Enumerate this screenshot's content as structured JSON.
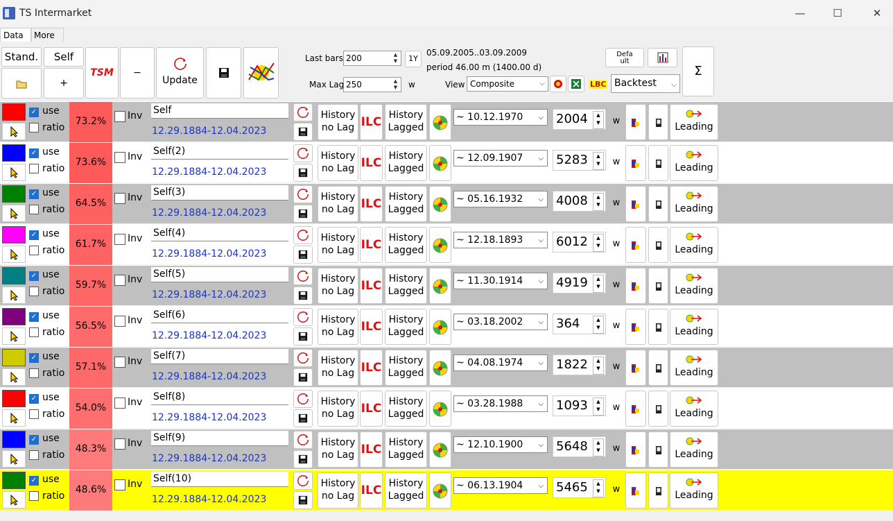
{
  "window": {
    "title": "TS Intermarket",
    "minimize": "—",
    "maximize": "☐",
    "close": "✕"
  },
  "tabs": [
    {
      "label": "Data"
    },
    {
      "label": "More"
    }
  ],
  "toolbar": {
    "stand_label": "Stand.",
    "self_label": "Self",
    "tsm_label": "TSM",
    "minus_label": "−",
    "plus_label": "+",
    "update_label": "Update",
    "last_bars_label": "Last bars",
    "last_bars_value": "200",
    "one_y_label": "1Y",
    "max_lag_label": "Max Lag",
    "max_lag_value": "250",
    "max_lag_unit": "w",
    "date_range": "05.09.2005..03.09.2009",
    "period": "period 46.00 m (1400.00 d)",
    "view_label": "View",
    "view_value": "Composite",
    "default_label_1": "Defa",
    "default_label_2": "ult",
    "lbc_label": "LBC",
    "backtest_value": "Backtest",
    "sigma_label": "Σ"
  },
  "row_labels": {
    "use": "use",
    "ratio": "ratio",
    "inv": "Inv",
    "history_nolag_1": "History",
    "history_nolag_2": "no Lag",
    "ilc": "ILC",
    "history_lagged_1": "History",
    "history_lagged_2": "Lagged",
    "unit": "w",
    "leading": "Leading"
  },
  "rows": [
    {
      "color": "#ff0000",
      "pct": "73.2%",
      "pct_color": "#ff5a5a",
      "name": "Self",
      "range": "12.29.1884-12.04.2023",
      "date": "~ 10.12.1970",
      "lag": "2004",
      "bg": "gray"
    },
    {
      "color": "#0000ff",
      "pct": "73.6%",
      "pct_color": "#ff5a5a",
      "name": "Self(2)",
      "range": "12.29.1884-12.04.2023",
      "date": "~ 12.09.1907",
      "lag": "5283",
      "bg": "white"
    },
    {
      "color": "#008000",
      "pct": "64.5%",
      "pct_color": "#ff6060",
      "name": "Self(3)",
      "range": "12.29.1884-12.04.2023",
      "date": "~ 05.16.1932",
      "lag": "4008",
      "bg": "gray"
    },
    {
      "color": "#ff00ff",
      "pct": "61.7%",
      "pct_color": "#ff6363",
      "name": "Self(4)",
      "range": "12.29.1884-12.04.2023",
      "date": "~ 12.18.1893",
      "lag": "6012",
      "bg": "white"
    },
    {
      "color": "#008080",
      "pct": "59.7%",
      "pct_color": "#ff6666",
      "name": "Self(5)",
      "range": "12.29.1884-12.04.2023",
      "date": "~ 11.30.1914",
      "lag": "4919",
      "bg": "gray"
    },
    {
      "color": "#800080",
      "pct": "56.5%",
      "pct_color": "#ff6a6a",
      "name": "Self(6)",
      "range": "12.29.1884-12.04.2023",
      "date": "~ 03.18.2002",
      "lag": "364",
      "bg": "white"
    },
    {
      "color": "#cccc00",
      "pct": "57.1%",
      "pct_color": "#ff6969",
      "name": "Self(7)",
      "range": "12.29.1884-12.04.2023",
      "date": "~ 04.08.1974",
      "lag": "1822",
      "bg": "gray"
    },
    {
      "color": "#ff0000",
      "pct": "54.0%",
      "pct_color": "#ff6e6e",
      "name": "Self(8)",
      "range": "12.29.1884-12.04.2023",
      "date": "~ 03.28.1988",
      "lag": "1093",
      "bg": "white"
    },
    {
      "color": "#0000ff",
      "pct": "48.3%",
      "pct_color": "#ff7a7a",
      "name": "Self(9)",
      "range": "12.29.1884-12.04.2023",
      "date": "~ 12.10.1900",
      "lag": "5648",
      "bg": "gray"
    },
    {
      "color": "#008000",
      "pct": "48.6%",
      "pct_color": "#ff7a7a",
      "name": "Self(10)",
      "range": "12.29.1884-12.04.2023",
      "date": "~ 06.13.1904",
      "lag": "5465",
      "bg": "yellow"
    }
  ]
}
